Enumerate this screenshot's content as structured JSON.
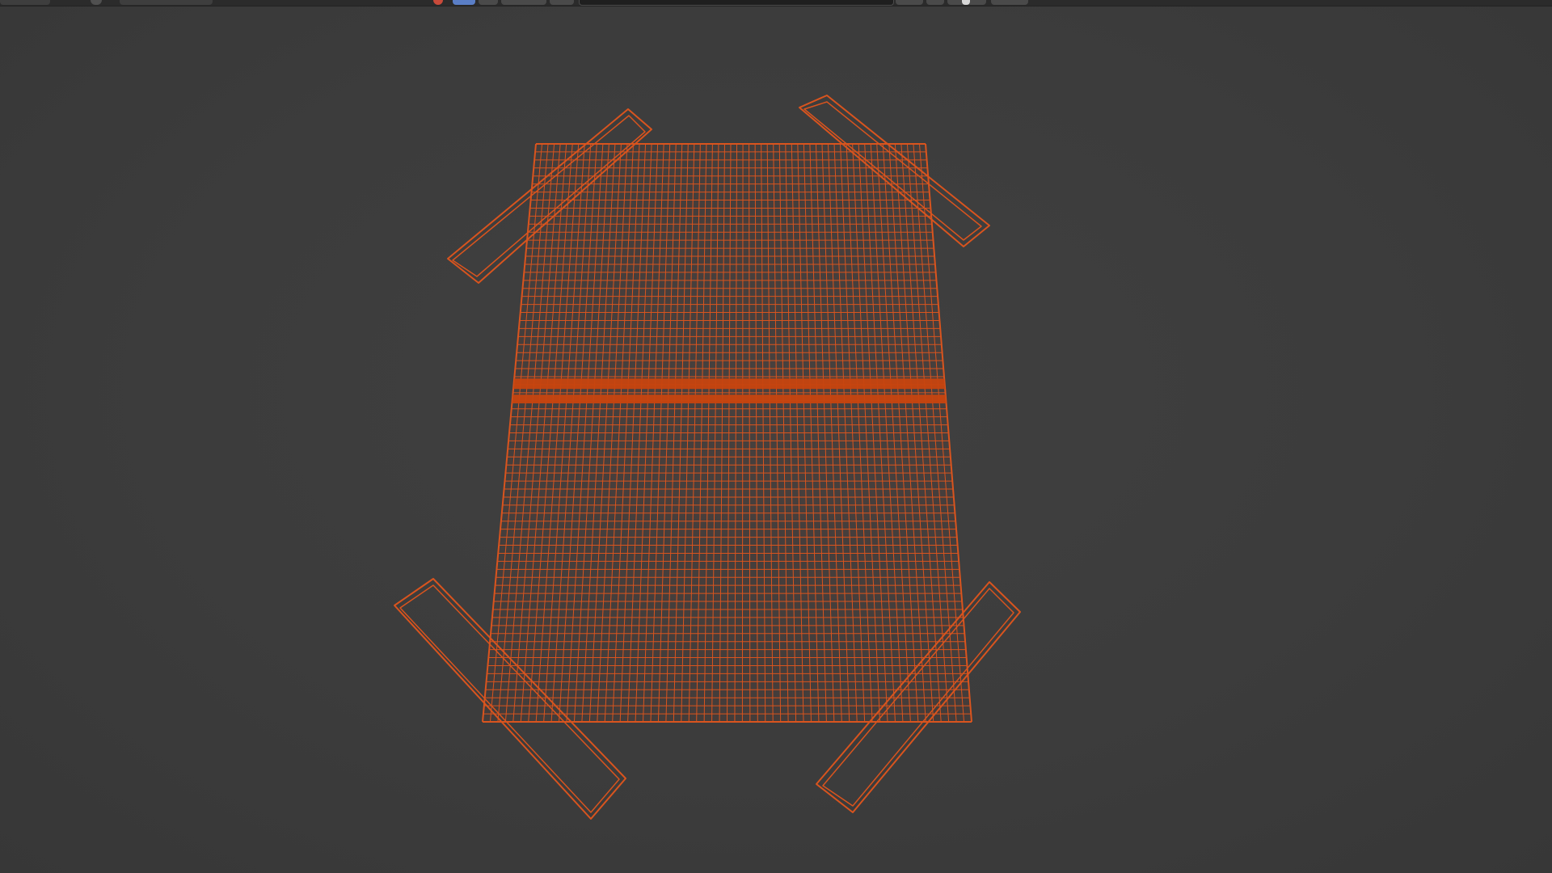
{
  "window": {
    "app": "3D viewport",
    "mode": "wireframe"
  },
  "header": {
    "icons": [
      "editor-type-icon",
      "view-mode-icon",
      "overlay-icon",
      "shading-icon"
    ]
  },
  "scene": {
    "objects": [
      {
        "name": "grid-plane",
        "type": "subdivided-plane",
        "selected": true
      },
      {
        "name": "leg-front-left",
        "type": "box",
        "selected": true
      },
      {
        "name": "leg-front-right",
        "type": "box",
        "selected": true
      },
      {
        "name": "leg-back-left",
        "type": "box",
        "selected": true
      },
      {
        "name": "leg-back-right",
        "type": "box",
        "selected": true
      }
    ],
    "colors": {
      "background": "#3b3b3b",
      "wire": "#d9541e",
      "wire_strong": "#c7440f",
      "header": "#2b2b2b"
    }
  }
}
